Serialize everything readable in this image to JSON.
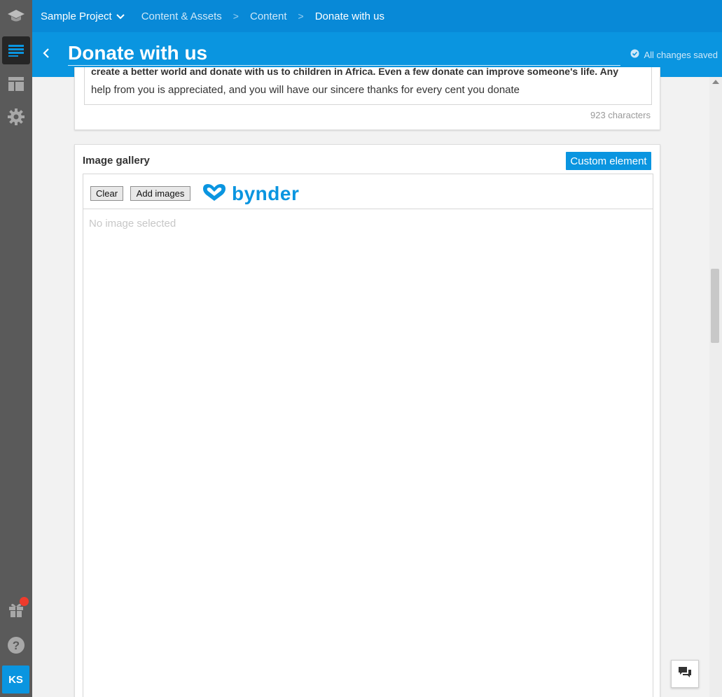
{
  "breadcrumb": {
    "project": "Sample Project",
    "items": [
      "Content & Assets",
      "Content"
    ],
    "current": "Donate with us"
  },
  "header": {
    "title": "Donate with us",
    "save_status": "All changes saved"
  },
  "text_field": {
    "partial_line": "create a better world and donate with us to children in Africa. Even a few donate can improve someone's life. Any",
    "line2": "help from you is appreciated, and you will have our sincere thanks for every cent you donate",
    "char_count": "923 characters"
  },
  "gallery": {
    "label": "Image gallery",
    "custom_element": "Custom element",
    "clear": "Clear",
    "add_images": "Add images",
    "logo_text": "bynder",
    "empty_text": "No image selected"
  },
  "user": {
    "initials": "KS"
  },
  "colors": {
    "primary": "#0a95e0",
    "topbar": "#0889d7",
    "rail": "#5a5a5a",
    "notification": "#ef3b2c"
  },
  "icons": {
    "rail": [
      "graduation-cap-icon",
      "content-list-icon",
      "layout-icon",
      "gear-icon",
      "gift-icon",
      "help-icon"
    ],
    "chat": "chat-icon"
  }
}
